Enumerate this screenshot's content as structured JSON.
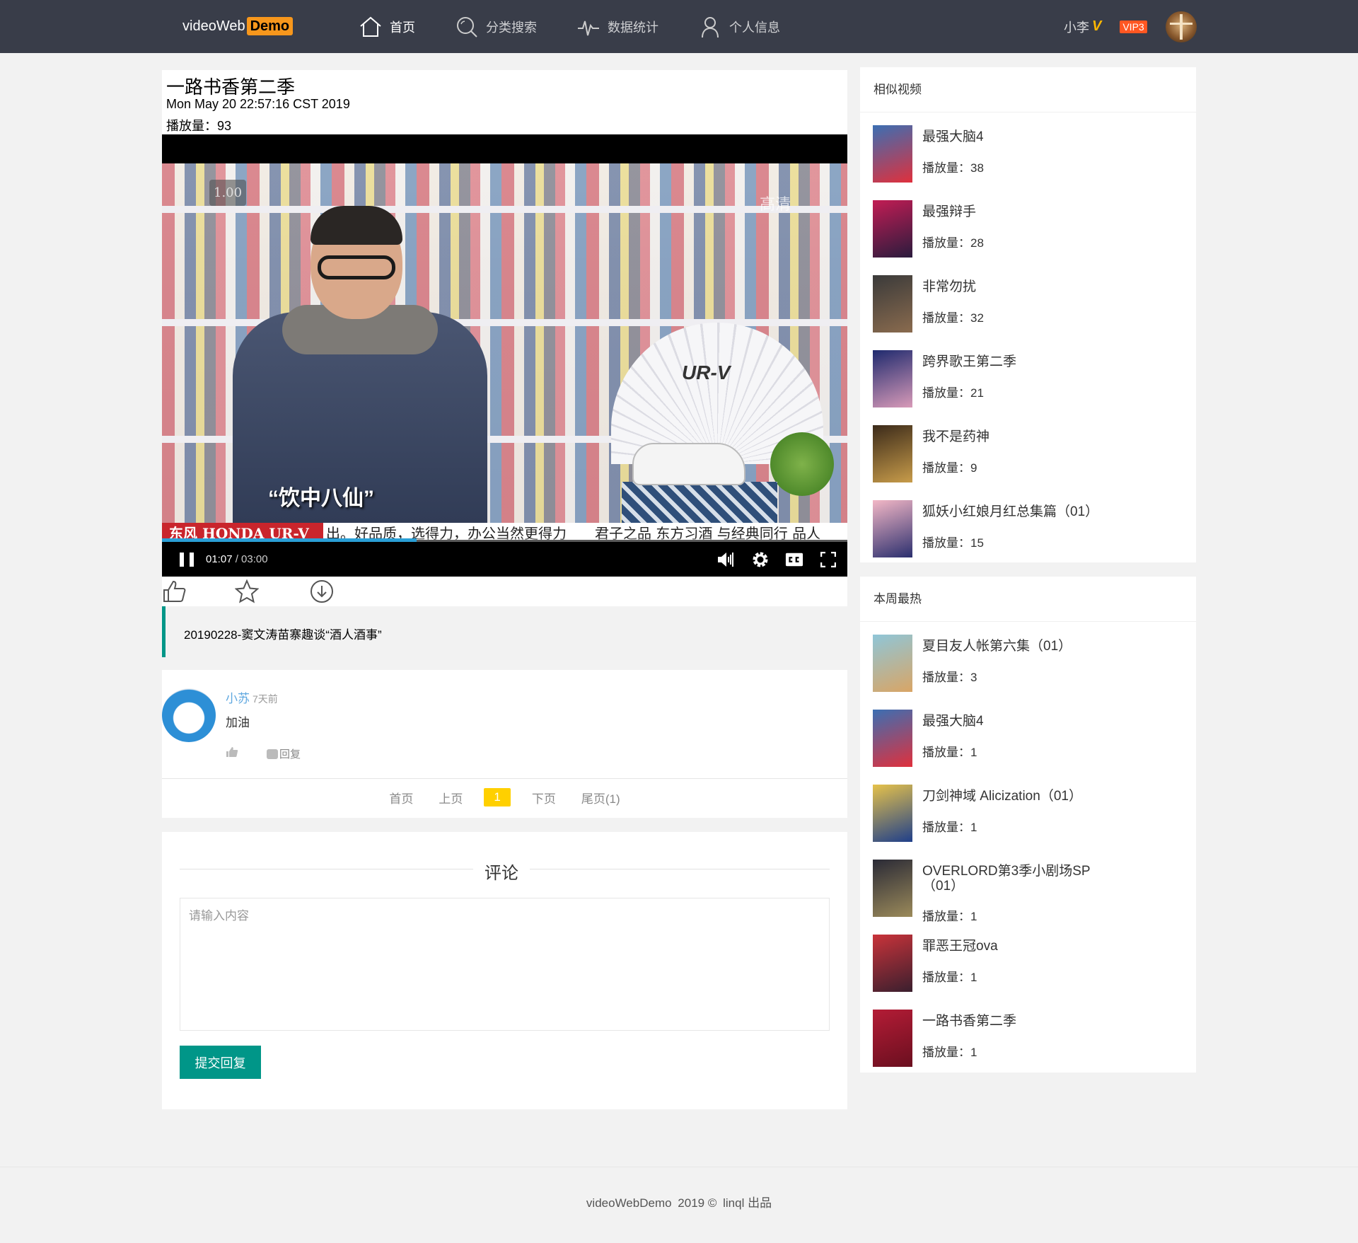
{
  "header": {
    "logo_text": "videoWeb",
    "logo_badge": "Demo",
    "nav": [
      {
        "label": "首页",
        "icon": "home-icon",
        "active": true
      },
      {
        "label": "分类搜索",
        "icon": "search-icon",
        "active": false
      },
      {
        "label": "数据统计",
        "icon": "pulse-icon",
        "active": false
      },
      {
        "label": "个人信息",
        "icon": "user-icon",
        "active": false
      }
    ],
    "user_name": "小李",
    "vip_mark": "V",
    "vip_level": "VIP3"
  },
  "video": {
    "title": "一路书香第二季",
    "date": "Mon May 20 22:57:16 CST 2019",
    "plays_label": "播放量：93",
    "player": {
      "speed": "1.00",
      "watermark": "高清",
      "caption": "“饮中八仙”",
      "ticker_brand": "东风 HONDA  UR-V",
      "ticker_text": "出。好品质，选得力，办公当然更得力　　君子之品 东方习酒 与经典同行 品人",
      "fan_text": "UR-V",
      "current_time": "01:07",
      "duration": "/ 03:00",
      "progress": 0.372,
      "accent_color": "#2a9fd6"
    },
    "actions": [
      {
        "name": "like",
        "icon": "thumbs-up-icon"
      },
      {
        "name": "favorite",
        "icon": "star-icon"
      },
      {
        "name": "download",
        "icon": "download-icon"
      }
    ],
    "description": "20190228-窦文涛苗寨趣谈“酒人酒事”"
  },
  "comments": {
    "items": [
      {
        "user": "小苏",
        "time": "7天前",
        "text": "加油",
        "reply_label": "回复"
      }
    ],
    "pager": {
      "first": "首页",
      "prev": "上页",
      "current": "1",
      "next": "下页",
      "last": "尾页(1)"
    }
  },
  "form": {
    "legend": "评论",
    "placeholder": "请输入内容",
    "submit": "提交回复",
    "accent_color": "#009688"
  },
  "similar": {
    "title": "相似视频",
    "items": [
      {
        "title": "最强大脑4",
        "plays": "播放量：38",
        "color1": "#3b6fb3",
        "color2": "#e0303c"
      },
      {
        "title": "最强辩手",
        "plays": "播放量：28",
        "color1": "#c21d54",
        "color2": "#2a1b3d"
      },
      {
        "title": "非常勿扰",
        "plays": "播放量：32",
        "color1": "#3a3a3a",
        "color2": "#8a6b4e"
      },
      {
        "title": "跨界歌王第二季",
        "plays": "播放量：21",
        "color1": "#1f2a6e",
        "color2": "#d89ab8"
      },
      {
        "title": "我不是药神",
        "plays": "播放量：9",
        "color1": "#3b2a1a",
        "color2": "#c89c4a"
      },
      {
        "title": "狐妖小红娘月红总集篇（01）",
        "plays": "播放量：15",
        "color1": "#f3b7c6",
        "color2": "#2b2f6e"
      }
    ]
  },
  "hot": {
    "title": "本周最热",
    "items": [
      {
        "title": "夏目友人帐第六集（01）",
        "plays": "播放量：3",
        "color1": "#8fc6d8",
        "color2": "#d9a565"
      },
      {
        "title": "最强大脑4",
        "plays": "播放量：1",
        "color1": "#3b6fb3",
        "color2": "#e0303c"
      },
      {
        "title": "刀剑神域 Alicization（01）",
        "plays": "播放量：1",
        "color1": "#e6c24a",
        "color2": "#1f3f8a"
      },
      {
        "title": "OVERLORD第3季小剧场SP（01）",
        "plays": "播放量：1",
        "color1": "#2a2a36",
        "color2": "#9b8a5a"
      },
      {
        "title": "罪恶王冠ova",
        "plays": "播放量：1",
        "color1": "#c9333a",
        "color2": "#3a1f2e"
      },
      {
        "title": "一路书香第二季",
        "plays": "播放量：1",
        "color1": "#b41c36",
        "color2": "#6a0f1f"
      }
    ]
  },
  "footer": {
    "site": "videoWebDemo",
    "copyright": "2019 ©",
    "author": "linql 出品"
  }
}
